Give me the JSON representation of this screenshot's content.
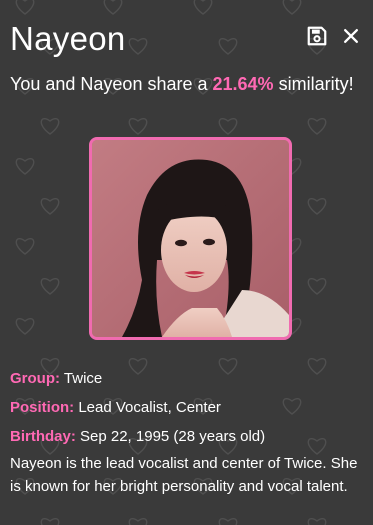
{
  "profile": {
    "name": "Nayeon",
    "similarity_prefix": "You and Nayeon share a",
    "similarity_value": "21.64%",
    "similarity_suffix": "similarity!",
    "fields": {
      "group_label": "Group:",
      "group_value": "Twice",
      "position_label": "Position:",
      "position_value": "Lead Vocalist, Center",
      "birthday_label": "Birthday:",
      "birthday_value": "Sep 22, 1995 (28 years old)"
    },
    "description": "Nayeon is the lead vocalist and center of Twice. She is known for her bright personality and vocal talent."
  },
  "icons": {
    "save": "save-icon",
    "close": "close-icon",
    "background": "heart-icon"
  },
  "colors": {
    "background": "#3a3a3a",
    "accent": "#ff69b4",
    "photo_border": "#f06bb0",
    "text": "#ffffff"
  }
}
